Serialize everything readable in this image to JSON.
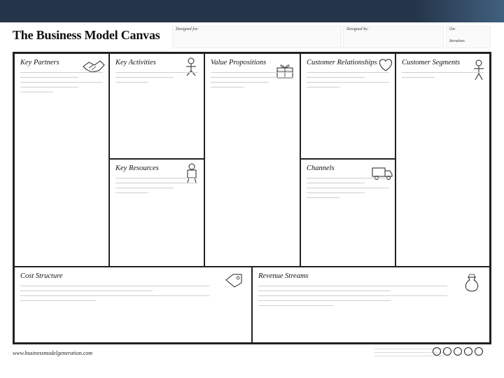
{
  "header": {
    "title": "The Business Model Canvas",
    "designed_for_label": "Designed for:",
    "designed_by_label": "Designed by:",
    "on_label": "On:",
    "iteration_label": "Iteration:"
  },
  "blocks": {
    "key_partners": {
      "title": "Key Partners",
      "icon": "handshake-icon"
    },
    "key_activities": {
      "title": "Key Activities",
      "icon": "worker-icon"
    },
    "value_propositions": {
      "title": "Value Propositions",
      "icon": "gift-icon"
    },
    "customer_relationships": {
      "title": "Customer Relationships",
      "icon": "heart-icon"
    },
    "customer_segments": {
      "title": "Customer Segments",
      "icon": "person-icon"
    },
    "key_resources": {
      "title": "Key Resources",
      "icon": "factory-worker-icon"
    },
    "channels": {
      "title": "Channels",
      "icon": "truck-icon"
    },
    "cost_structure": {
      "title": "Cost Structure",
      "icon": "price-tag-icon"
    },
    "revenue_streams": {
      "title": "Revenue Streams",
      "icon": "money-bag-icon"
    }
  },
  "footer": {
    "url": "www.businessmodelgeneration.com"
  },
  "colors": {
    "topbar": "#243549",
    "border": "#222222"
  }
}
